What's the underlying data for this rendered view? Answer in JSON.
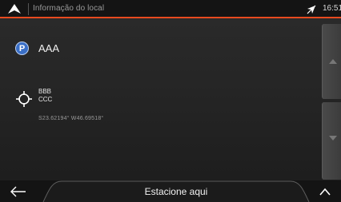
{
  "header": {
    "title": "Informação do local",
    "time": "16:51",
    "accent_color": "#e84a1f"
  },
  "poi": {
    "icon": "parking-icon",
    "icon_letter": "P",
    "name": "AAA"
  },
  "location": {
    "icon": "target-crosshair-icon",
    "address_line1": "BBB",
    "address_line2": "CCC",
    "coordinates": "S23.62194° W46.69518°"
  },
  "scroll": {
    "up_icon": "triangle-up-icon",
    "down_icon": "triangle-down-icon"
  },
  "footer": {
    "back_icon": "back-arrow-icon",
    "action_label": "Estacione aqui",
    "menu_icon": "chevron-up-icon"
  }
}
